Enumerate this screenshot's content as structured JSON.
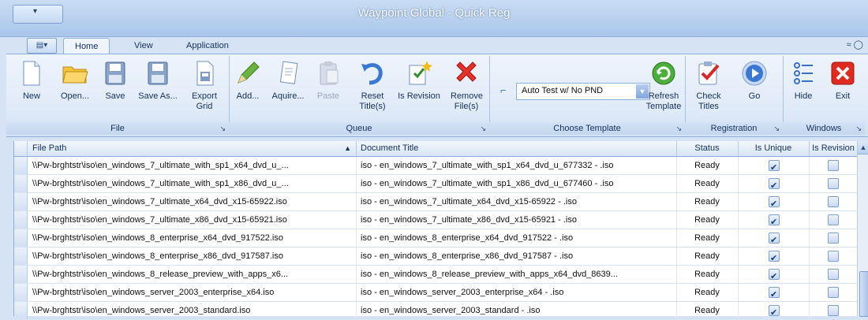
{
  "window": {
    "title": "Waypoint Global - Quick Reg"
  },
  "tabs": [
    {
      "label": "Home",
      "active": true
    },
    {
      "label": "View",
      "active": false
    },
    {
      "label": "Application",
      "active": false
    }
  ],
  "ribbon": {
    "file": {
      "label": "File",
      "buttons": [
        {
          "label": "New",
          "icon": "new-document-icon"
        },
        {
          "label": "Open...",
          "icon": "folder-open-icon"
        },
        {
          "label": "Save",
          "icon": "floppy-save-icon"
        },
        {
          "label": "Save As...",
          "icon": "floppy-save-as-icon"
        },
        {
          "label": "Export Grid",
          "icon": "export-grid-icon"
        }
      ]
    },
    "queue": {
      "label": "Queue",
      "buttons": [
        {
          "label": "Add...",
          "icon": "pencil-add-icon"
        },
        {
          "label": "Aquire...",
          "icon": "acquire-document-icon"
        },
        {
          "label": "Paste",
          "icon": "paste-icon",
          "disabled": true
        },
        {
          "label": "Reset Title(s)",
          "icon": "undo-arrow-icon"
        },
        {
          "label": "Is Revision",
          "icon": "revision-star-icon"
        },
        {
          "label": "Remove File(s)",
          "icon": "red-x-icon"
        }
      ]
    },
    "template": {
      "label": "Choose Template",
      "selected": "Auto Test w/ No PND",
      "refresh_label": "Refresh Template"
    },
    "registration": {
      "label": "Registration",
      "buttons": [
        {
          "label": "Check Titles",
          "icon": "clipboard-check-icon"
        },
        {
          "label": "Go",
          "icon": "play-circle-icon"
        }
      ]
    },
    "windows": {
      "label": "Windows",
      "buttons": [
        {
          "label": "Hide",
          "icon": "hide-list-icon"
        },
        {
          "label": "Exit",
          "icon": "exit-x-icon"
        }
      ]
    }
  },
  "grid": {
    "columns": [
      "File Path",
      "Document Title",
      "Status",
      "Is Unique",
      "Is Revision"
    ],
    "rows": [
      {
        "path": "\\\\Pw-brghtstr\\iso\\en_windows_7_ultimate_with_sp1_x64_dvd_u_...",
        "title": "iso - en_windows_7_ultimate_with_sp1_x64_dvd_u_677332 - .iso",
        "status": "Ready",
        "unique": true,
        "revision": false
      },
      {
        "path": "\\\\Pw-brghtstr\\iso\\en_windows_7_ultimate_with_sp1_x86_dvd_u_...",
        "title": "iso - en_windows_7_ultimate_with_sp1_x86_dvd_u_677460 - .iso",
        "status": "Ready",
        "unique": true,
        "revision": false
      },
      {
        "path": "\\\\Pw-brghtstr\\iso\\en_windows_7_ultimate_x64_dvd_x15-65922.iso",
        "title": "iso - en_windows_7_ultimate_x64_dvd_x15-65922 - .iso",
        "status": "Ready",
        "unique": true,
        "revision": false
      },
      {
        "path": "\\\\Pw-brghtstr\\iso\\en_windows_7_ultimate_x86_dvd_x15-65921.iso",
        "title": "iso - en_windows_7_ultimate_x86_dvd_x15-65921 - .iso",
        "status": "Ready",
        "unique": true,
        "revision": false
      },
      {
        "path": "\\\\Pw-brghtstr\\iso\\en_windows_8_enterprise_x64_dvd_917522.iso",
        "title": "iso - en_windows_8_enterprise_x64_dvd_917522 - .iso",
        "status": "Ready",
        "unique": true,
        "revision": false
      },
      {
        "path": "\\\\Pw-brghtstr\\iso\\en_windows_8_enterprise_x86_dvd_917587.iso",
        "title": "iso - en_windows_8_enterprise_x86_dvd_917587 - .iso",
        "status": "Ready",
        "unique": true,
        "revision": false
      },
      {
        "path": "\\\\Pw-brghtstr\\iso\\en_windows_8_release_preview_with_apps_x6...",
        "title": "iso - en_windows_8_release_preview_with_apps_x64_dvd_8639...",
        "status": "Ready",
        "unique": true,
        "revision": false
      },
      {
        "path": "\\\\Pw-brghtstr\\iso\\en_windows_server_2003_enterprise_x64.iso",
        "title": "iso - en_windows_server_2003_enterprise_x64 - .iso",
        "status": "Ready",
        "unique": true,
        "revision": false
      },
      {
        "path": "\\\\Pw-brghtstr\\iso\\en_windows_server_2003_standard.iso",
        "title": "iso - en_windows_server_2003_standard - .iso",
        "status": "Ready",
        "unique": true,
        "revision": false
      }
    ]
  }
}
